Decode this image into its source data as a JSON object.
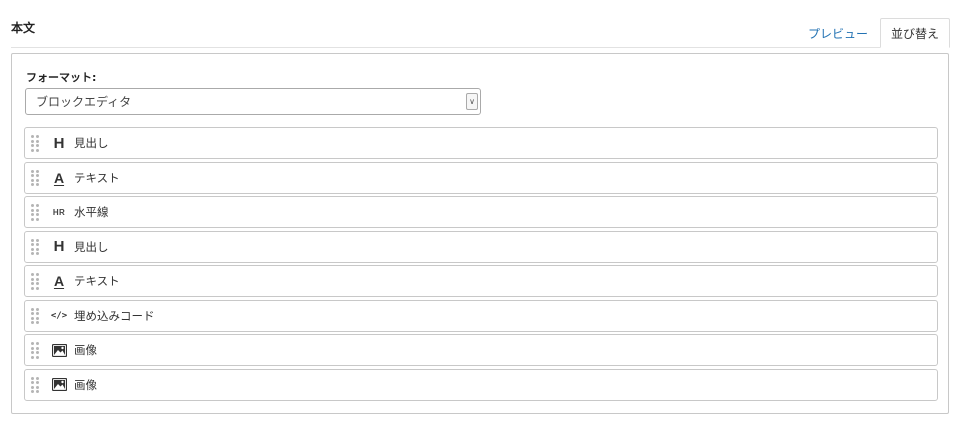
{
  "section": {
    "title": "本文"
  },
  "tabs": {
    "preview": "プレビュー",
    "sort": "並び替え"
  },
  "format": {
    "label": "フォーマット:",
    "selected": "ブロックエディタ"
  },
  "blocks": [
    {
      "icon": "heading-icon",
      "glyph": "H",
      "label": "見出し"
    },
    {
      "icon": "text-icon",
      "glyph": "A",
      "label": "テキスト"
    },
    {
      "icon": "horizontal-rule-icon",
      "glyph": "HR",
      "label": "水平線"
    },
    {
      "icon": "heading-icon",
      "glyph": "H",
      "label": "見出し"
    },
    {
      "icon": "text-icon",
      "glyph": "A",
      "label": "テキスト"
    },
    {
      "icon": "code-icon",
      "glyph": "</>",
      "label": "埋め込みコード"
    },
    {
      "icon": "image-icon",
      "glyph": "",
      "label": "画像"
    },
    {
      "icon": "image-icon",
      "glyph": "",
      "label": "画像"
    }
  ],
  "colors": {
    "link": "#2272b3",
    "border": "#c8c8c8"
  }
}
